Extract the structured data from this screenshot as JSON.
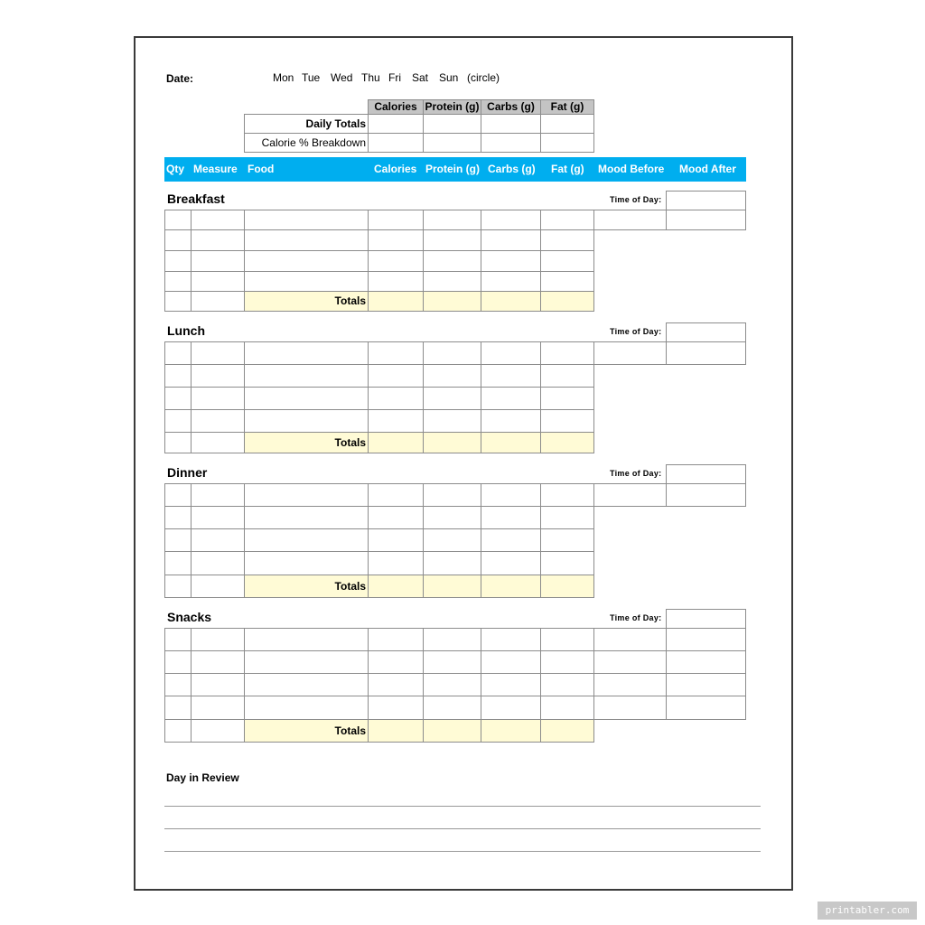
{
  "header": {
    "date_label": "Date:",
    "days": [
      "Mon",
      "Tue",
      "Wed",
      "Thu",
      "Fri",
      "Sat",
      "Sun"
    ],
    "circle_note": "(circle)"
  },
  "summary": {
    "columns": [
      "Calories",
      "Protein (g)",
      "Carbs (g)",
      "Fat (g)"
    ],
    "rows": [
      "Daily Totals",
      "Calorie % Breakdown"
    ]
  },
  "columns": [
    "Qty",
    "Measure",
    "Food",
    "Calories",
    "Protein (g)",
    "Carbs (g)",
    "Fat (g)",
    "Mood Before",
    "Mood After"
  ],
  "meals": [
    {
      "title": "Breakfast",
      "time_label": "Time of Day:",
      "totals_label": "Totals"
    },
    {
      "title": "Lunch",
      "time_label": "Time of Day:",
      "totals_label": "Totals"
    },
    {
      "title": "Dinner",
      "time_label": "Time of Day:",
      "totals_label": "Totals"
    },
    {
      "title": "Snacks",
      "time_label": "Time of Day:",
      "totals_label": "Totals"
    }
  ],
  "review": {
    "title": "Day in Review"
  },
  "watermark": "printabler.com",
  "colors": {
    "header_bar": "#00aeef",
    "totals_fill": "#fffbd6",
    "summary_header": "#c4c4c4"
  }
}
